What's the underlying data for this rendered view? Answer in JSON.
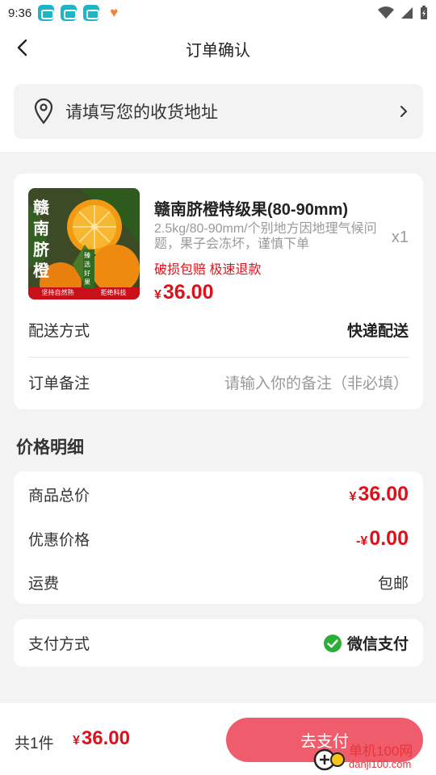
{
  "status_bar": {
    "time": "9:36"
  },
  "header": {
    "title": "订单确认"
  },
  "address": {
    "placeholder_text": "请填写您的收货地址"
  },
  "product": {
    "name": "赣南脐橙特级果(80-90mm)",
    "spec": "2.5kg/80-90mm/个别地方因地理气候问题，果子会冻坏，谨慎下单",
    "quantity": "x1",
    "tags": "破损包赔 极速退款",
    "currency": "¥",
    "price": "36.00",
    "image_text": {
      "vertical": "赣南脐橙",
      "badge": "臻选好果",
      "banner_left": "坚持自然熟",
      "banner_right": "拒绝科技"
    }
  },
  "order": {
    "delivery_label": "配送方式",
    "delivery_value": "快递配送",
    "note_label": "订单备注",
    "note_placeholder": "请输入你的备注（非必填）"
  },
  "price_detail": {
    "section_title": "价格明细",
    "total_label": "商品总价",
    "total_currency": "¥",
    "total_value": "36.00",
    "discount_label": "优惠价格",
    "discount_prefix": "-¥",
    "discount_value": "0.00",
    "shipping_label": "运费",
    "shipping_value": "包邮"
  },
  "payment": {
    "label": "支付方式",
    "method": "微信支付"
  },
  "footer": {
    "count_text": "共1件",
    "currency": "¥",
    "total": "36.00",
    "pay_button": "去支付"
  },
  "watermark": {
    "line1": "单机100网",
    "line2": "danji100.com"
  },
  "colors": {
    "accent_red": "#e0101a",
    "pay_button": "#ef5c6b",
    "wechat_green": "#2aae38"
  }
}
